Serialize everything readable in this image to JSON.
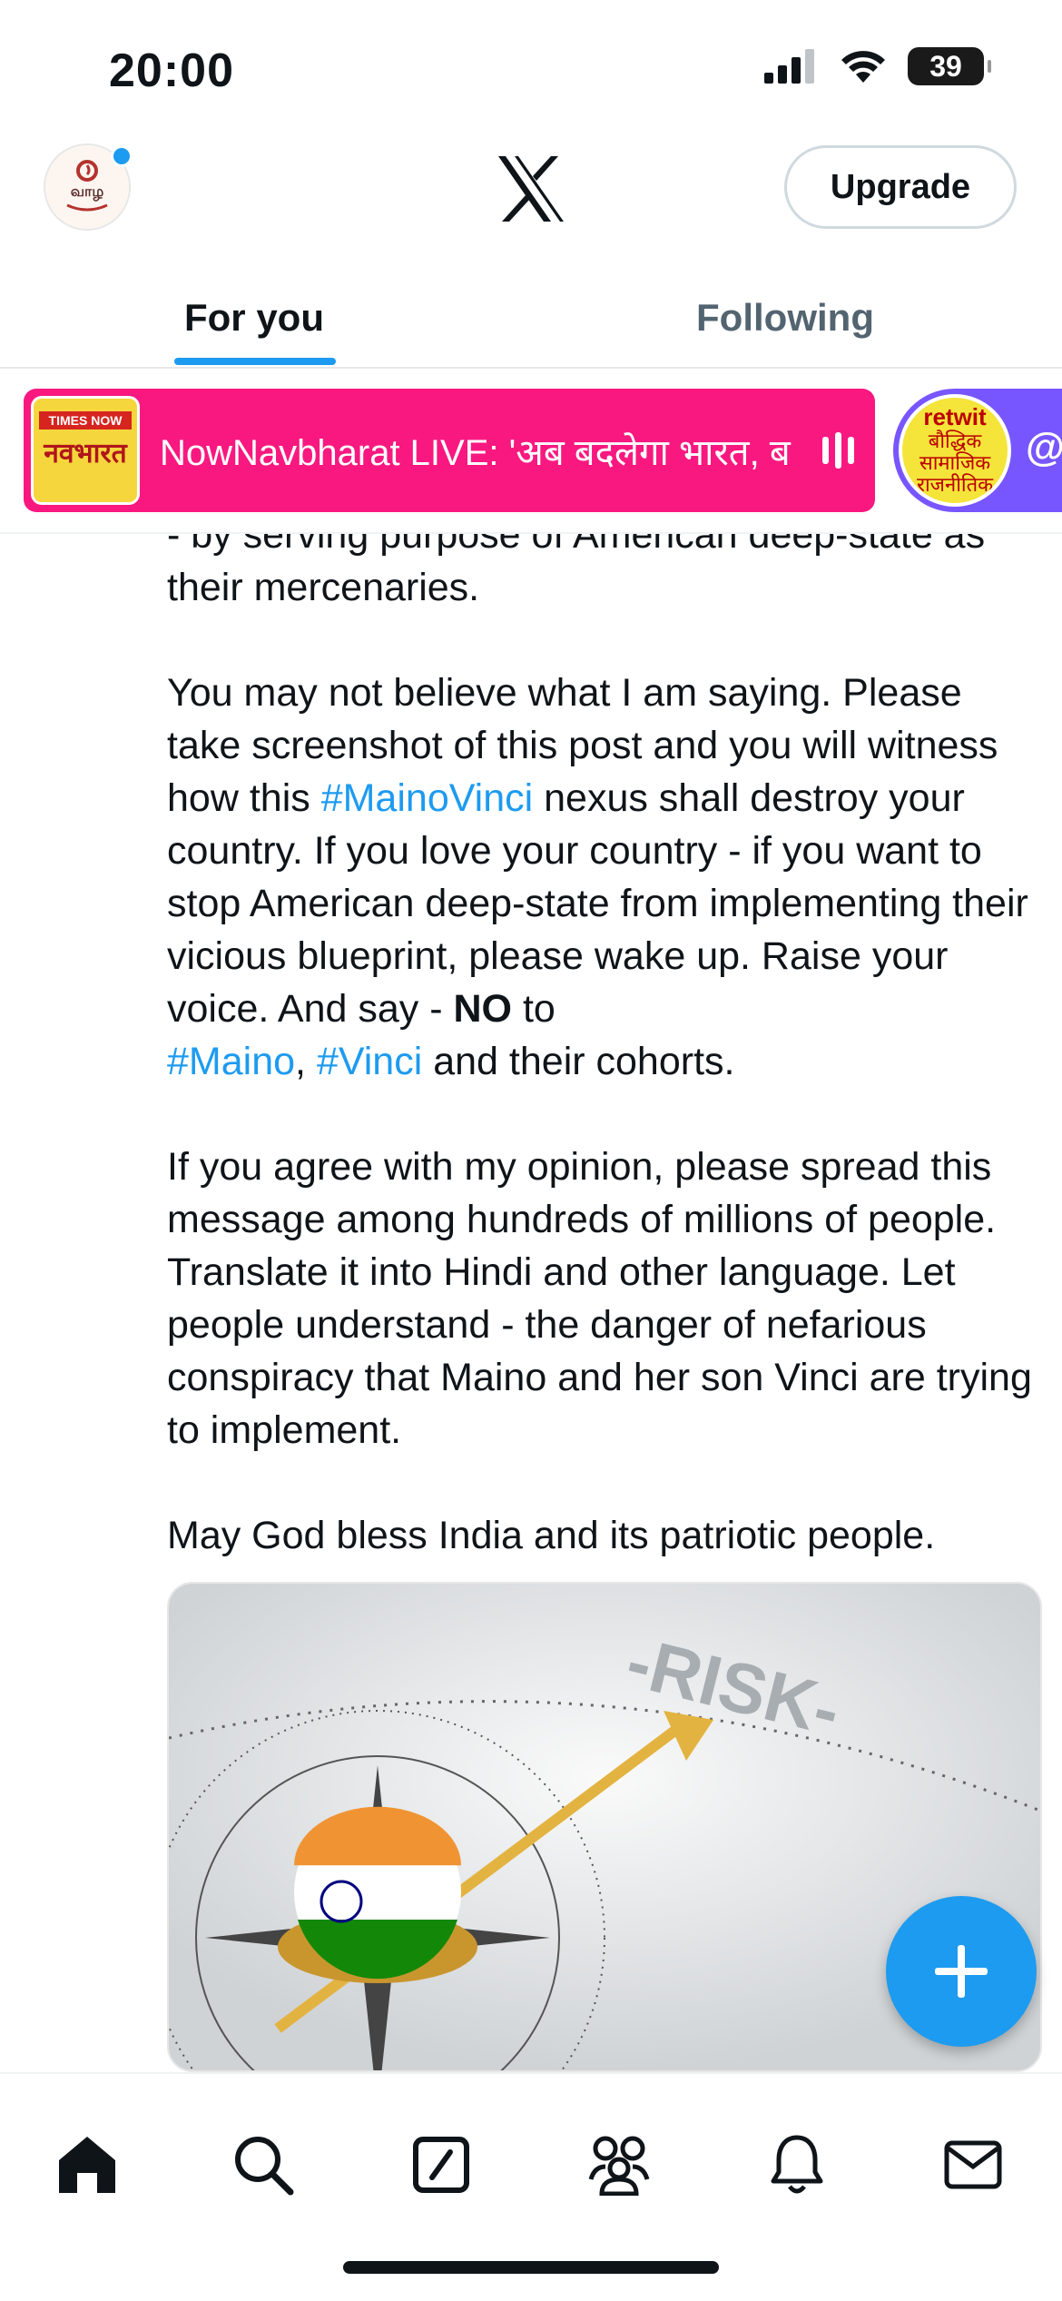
{
  "status_bar": {
    "time": "20:00",
    "battery": "39"
  },
  "header": {
    "upgrade_label": "Upgrade",
    "logo": "x-logo-icon"
  },
  "tabs": [
    {
      "label": "For you",
      "active": true
    },
    {
      "label": "Following",
      "active": false
    }
  ],
  "spaces": {
    "live_title": "NowNavbharat LIVE: 'अब बदलेगा भारत, ब",
    "thumb_top": "TIMES NOW",
    "thumb_main": "नवभारत",
    "second_thumb_lines": [
      "retwit",
      "बौद्धिक",
      "सामाजिक",
      "राजनीतिक"
    ],
    "second_at": "@"
  },
  "post": {
    "line_partial": "- by serving purpose of American deep-state as their mercenaries.",
    "p2_a": "You may not believe what I am saying. Please take screenshot of this post and you will witness how this ",
    "p2_tag": "#MainoVinci",
    "p2_b": " nexus shall destroy your country. If you love your country - if you want to stop American deep-state from implementing their vicious blueprint, please wake up. Raise your voice. And say - ",
    "p2_bold": "NO",
    "p2_c": " to ",
    "p2_tag2": "#Maino",
    "p2_comma": ", ",
    "p2_tag3": "#Vinci",
    "p2_d": " and their cohorts.",
    "p3": "If you agree with my opinion, please spread this message among hundreds of millions of people. Translate it into Hindi and other language. Let people understand - the danger of nefarious conspiracy that Maino and her son Vinci are trying to implement.",
    "p4": "May God bless India and its patriotic people.",
    "media_text": "-RISK-"
  },
  "colors": {
    "accent": "#1d9bf0",
    "space_pink": "#f91880",
    "space_purple": "#7856ff"
  },
  "bottom_nav": [
    "home-icon",
    "search-icon",
    "grok-icon",
    "communities-icon",
    "notifications-icon",
    "messages-icon"
  ]
}
